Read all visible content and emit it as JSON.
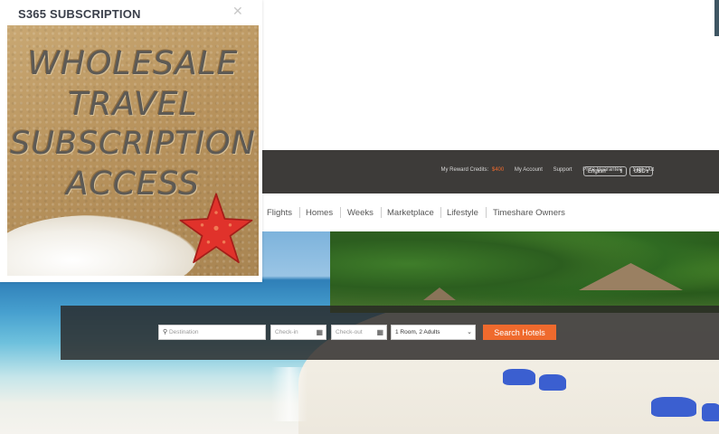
{
  "popup": {
    "title": "S365 SUBSCRIPTION",
    "close_icon": "close-icon",
    "image_text": [
      "WHOLESALE",
      "TRAVEL",
      "SUBSCRIPTION",
      "ACCESS"
    ]
  },
  "header": {
    "reward_label": "My Reward Credits:",
    "reward_value": "$400",
    "links": [
      "My Account",
      "Support",
      "Price Guarantee",
      "Sign Out"
    ],
    "language": "English",
    "currency": "USD"
  },
  "nav": {
    "items": [
      "Flights",
      "Homes",
      "Weeks",
      "Marketplace",
      "Lifestyle",
      "Timeshare Owners"
    ]
  },
  "search": {
    "destination_placeholder": "Destination",
    "checkin_placeholder": "Check-in",
    "checkout_placeholder": "Check-out",
    "rooms_value": "1 Room, 2 Adults",
    "button_label": "Search Hotels"
  },
  "colors": {
    "accent": "#ef6a2d",
    "topbar": "#3d3b39"
  }
}
